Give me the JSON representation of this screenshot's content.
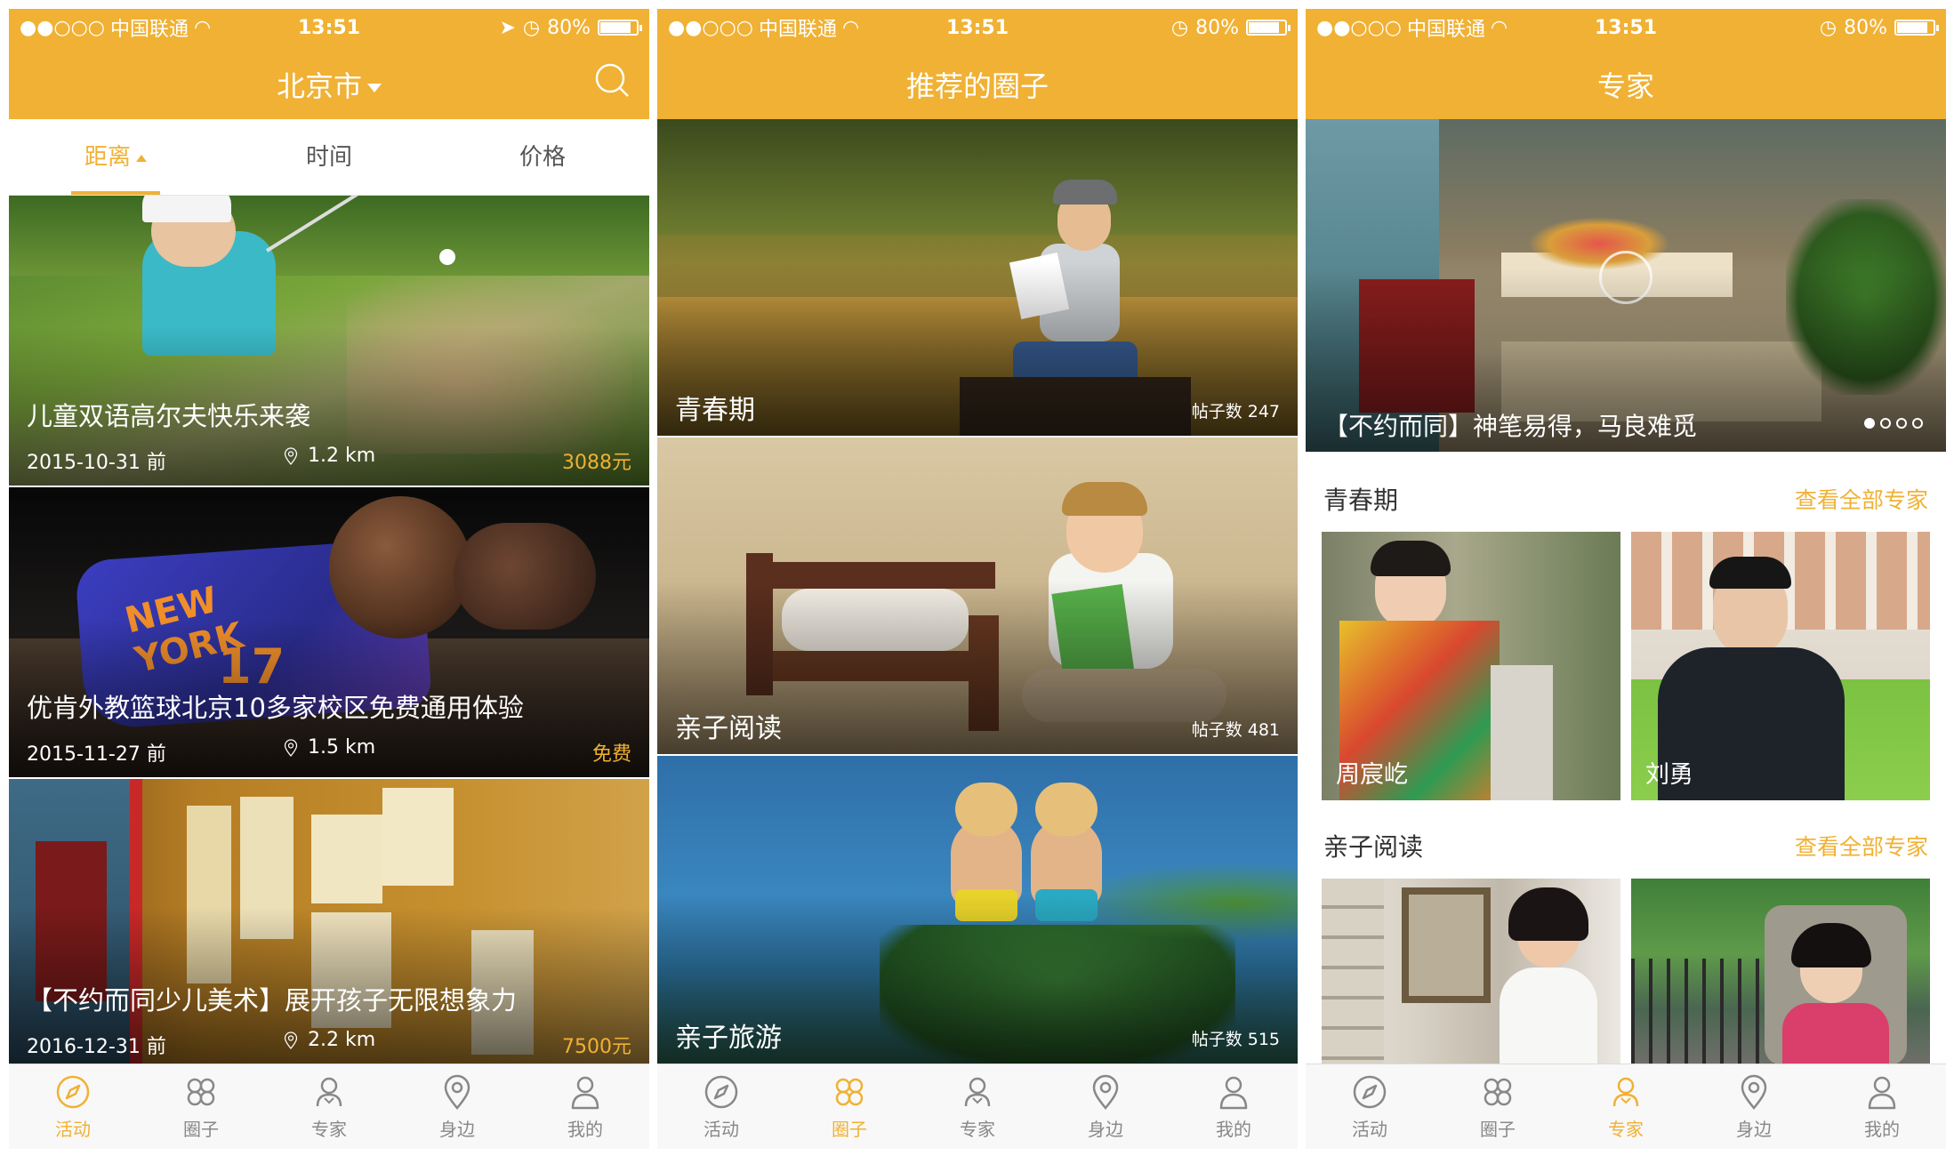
{
  "status": {
    "carrier": "中国联通",
    "time": "13:51",
    "battery": "80%",
    "battery_level": 0.8
  },
  "colors": {
    "accent": "#f0b134"
  },
  "screen1": {
    "city": "北京市",
    "tabs": [
      {
        "label": "距离"
      },
      {
        "label": "时间"
      },
      {
        "label": "价格"
      }
    ],
    "events": [
      {
        "title": "儿童双语高尔夫快乐来袭",
        "date": "2015-10-31 前",
        "distance": "1.2 km",
        "price": "3088元"
      },
      {
        "title": "优肯外教篮球北京10多家校区免费通用体验",
        "date": "2015-11-27 前",
        "distance": "1.5 km",
        "price": "免费"
      },
      {
        "title": "【不约而同少儿美术】展开孩子无限想象力",
        "date": "2016-12-31 前",
        "distance": "2.2 km",
        "price": "7500元"
      }
    ]
  },
  "screen2": {
    "title": "推荐的圈子",
    "circles": [
      {
        "name": "青春期",
        "count": "帖子数 247"
      },
      {
        "name": "亲子阅读",
        "count": "帖子数 481"
      },
      {
        "name": "亲子旅游",
        "count": "帖子数 515"
      }
    ]
  },
  "screen3": {
    "title": "专家",
    "banner": "【不约而同】神笔易得，马良难觅",
    "sections": [
      {
        "title": "青春期",
        "link": "查看全部专家",
        "experts": [
          {
            "name": "周宸屹"
          },
          {
            "name": "刘勇"
          }
        ]
      },
      {
        "title": "亲子阅读",
        "link": "查看全部专家",
        "experts": [
          {
            "name": ""
          },
          {
            "name": ""
          }
        ]
      }
    ]
  },
  "tabbar": [
    {
      "label": "活动"
    },
    {
      "label": "圈子"
    },
    {
      "label": "专家"
    },
    {
      "label": "身边"
    },
    {
      "label": "我的"
    }
  ]
}
